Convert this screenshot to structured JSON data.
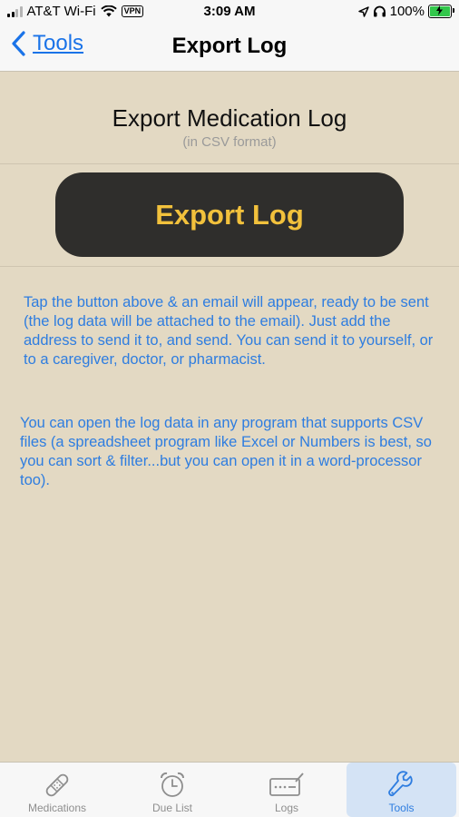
{
  "status_bar": {
    "carrier": "AT&T Wi-Fi",
    "vpn": "VPN",
    "time": "3:09 AM",
    "battery": "100%",
    "icons": [
      "signal-icon",
      "wifi-icon",
      "location-icon",
      "headphones-icon",
      "battery-charging-icon"
    ]
  },
  "nav": {
    "back_label": "Tools",
    "title": "Export Log"
  },
  "section": {
    "title": "Export Medication Log",
    "subtitle": "(in CSV format)"
  },
  "export_button": "Export Log",
  "paragraphs": [
    "Tap the button above & an email will appear, ready to be sent (the log data will be attached to the email). Just add the address to send it to, and send. You can send it to yourself, or to a caregiver, doctor, or pharmacist.",
    "You can open the log data in any program that supports CSV files (a spreadsheet program like Excel or Numbers is best, so you can sort & filter...but you can open it in a word-processor too)."
  ],
  "tabs": [
    {
      "label": "Medications",
      "icon": "bandage-icon",
      "active": false
    },
    {
      "label": "Due List",
      "icon": "alarm-clock-icon",
      "active": false
    },
    {
      "label": "Logs",
      "icon": "log-pad-icon",
      "active": false
    },
    {
      "label": "Tools",
      "icon": "wrench-icon",
      "active": true
    }
  ],
  "colors": {
    "background": "#e3d9c3",
    "button": "#2f2e2c",
    "button_text": "#f2c13c",
    "link": "#2e7de0"
  }
}
